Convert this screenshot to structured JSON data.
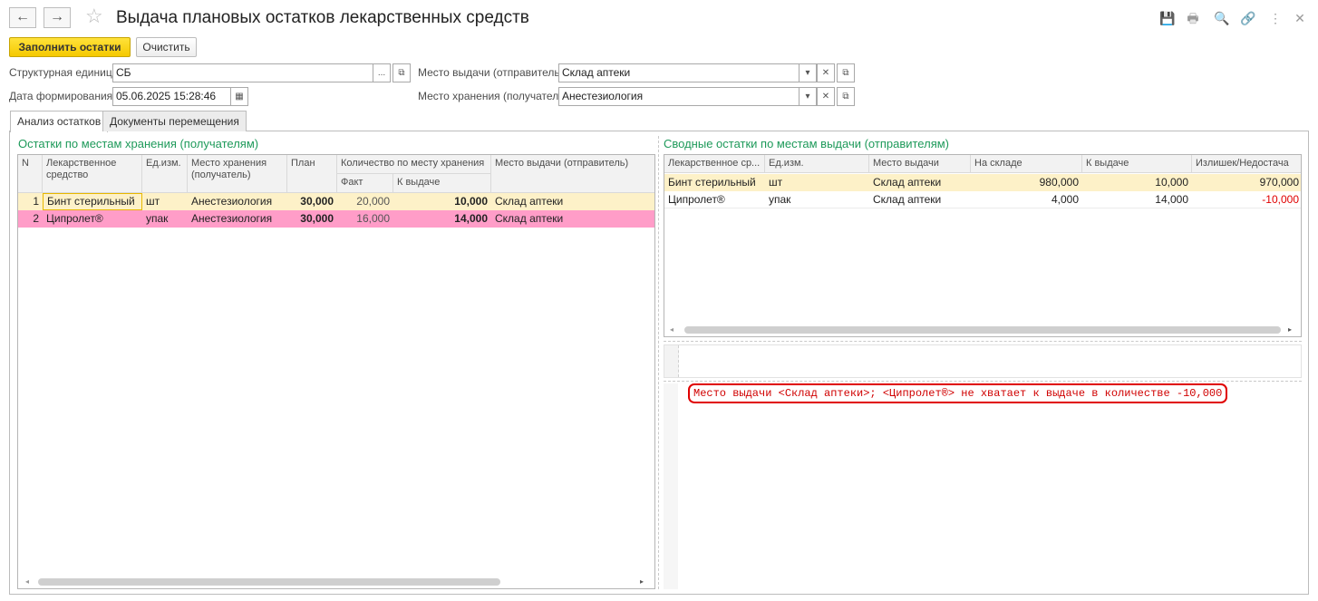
{
  "window": {
    "title": "Выдача плановых остатков лекарственных средств",
    "back_icon": "←",
    "forward_icon": "→",
    "favorite_icon": "☆",
    "tool_icons": [
      "💾",
      "🖶",
      "🔍",
      "🔗",
      "⋮",
      "✕"
    ]
  },
  "toolbar": {
    "fill_label": "Заполнить остатки",
    "clear_label": "Очистить"
  },
  "form": {
    "unit_label": "Структурная единица:",
    "unit_value": "СБ",
    "date_label": "Дата формирования:",
    "date_value": "05.06.2025 15:28:46",
    "issue_place_label": "Место выдачи (отправитель):",
    "issue_place_value": "Склад аптеки",
    "storage_place_label": "Место хранения (получатель):",
    "storage_place_value": "Анестезиология"
  },
  "tabs": [
    {
      "label": "Анализ остатков"
    },
    {
      "label": "Документы перемещения"
    }
  ],
  "left_section": {
    "title": "Остатки по местам хранения (получателям)",
    "headers": {
      "n": "N",
      "drug": "Лекарственное средство",
      "unit": "Ед.изм.",
      "storage": "Место хранения (получатель)",
      "plan": "План",
      "qty_group": "Количество по  месту хранения",
      "fact": "Факт",
      "to_issue": "К выдаче",
      "issue_place": "Место выдачи (отправитель)"
    },
    "rows": [
      {
        "n": "1",
        "drug": "Бинт стерильный",
        "unit": "шт",
        "storage": "Анестезиология",
        "plan": "30,000",
        "fact": "20,000",
        "to_issue": "10,000",
        "issue_place": "Склад аптеки"
      },
      {
        "n": "2",
        "drug": "Ципролет®",
        "unit": "упак",
        "storage": "Анестезиология",
        "plan": "30,000",
        "fact": "16,000",
        "to_issue": "14,000",
        "issue_place": "Склад аптеки"
      }
    ]
  },
  "right_section": {
    "title": "Сводные остатки по местам выдачи (отправителям)",
    "headers": {
      "drug": "Лекарственное ср...",
      "unit": "Ед.изм.",
      "issue_place": "Место выдачи",
      "in_stock": "На складе",
      "to_issue": "К выдаче",
      "diff": "Излишек/Недостача"
    },
    "rows": [
      {
        "drug": "Бинт стерильный",
        "unit": "шт",
        "issue_place": "Склад аптеки",
        "in_stock": "980,000",
        "to_issue": "10,000",
        "diff": "970,000"
      },
      {
        "drug": "Ципролет®",
        "unit": "упак",
        "issue_place": "Склад аптеки",
        "in_stock": "4,000",
        "to_issue": "14,000",
        "diff": "-10,000"
      }
    ]
  },
  "message": "Место выдачи <Склад аптеки>; <Ципролет®> не хватает к  выдаче в количестве -10,000",
  "colors": {
    "accent_green": "#1e9a5a",
    "selected_row": "#fdf1c8",
    "error_row": "#ff9dc8",
    "error_text": "#e00000",
    "primary_button": "#f5c900"
  }
}
